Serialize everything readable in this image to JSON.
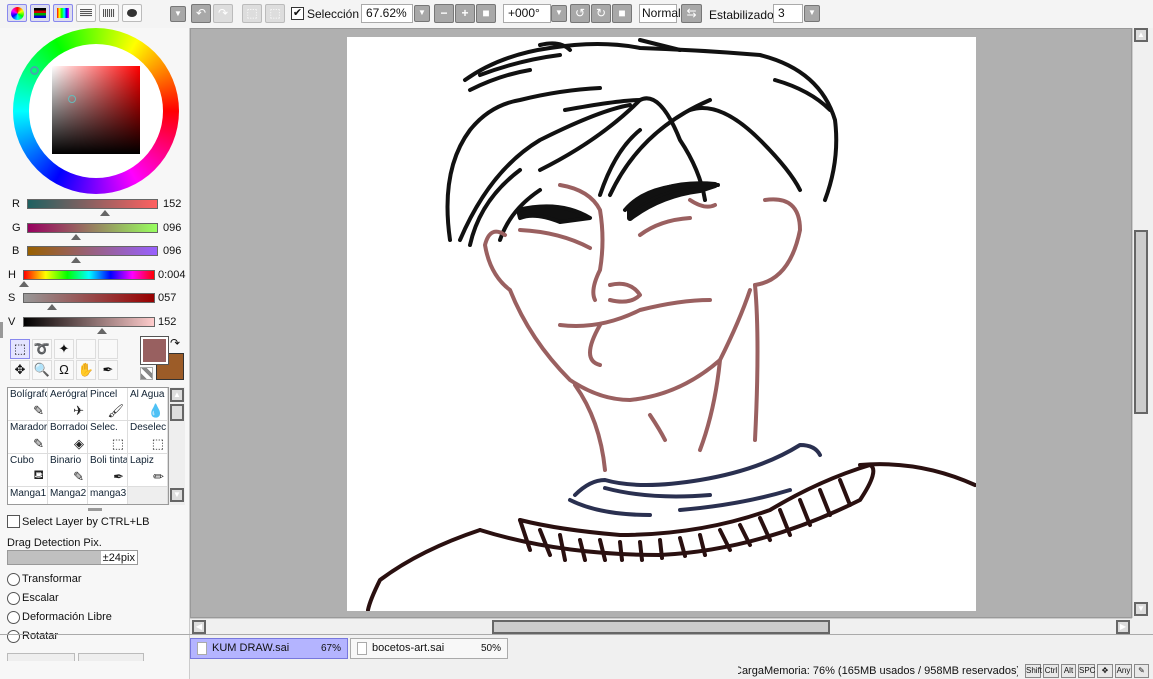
{
  "toolbar": {
    "selection_label": "Selección",
    "selection_checked": true,
    "zoom_value": "67.62%",
    "rotation_value": "+000°",
    "blend_mode": "Normal",
    "stabilizer_label": "Estabilizador",
    "stabilizer_value": "3"
  },
  "color": {
    "sliders": [
      {
        "label": "R",
        "value": "152",
        "fraction": 0.596
      },
      {
        "label": "G",
        "value": "096",
        "fraction": 0.376
      },
      {
        "label": "B",
        "value": "096",
        "fraction": 0.376
      },
      {
        "label": "H",
        "value": "0:004",
        "fraction": 0.01
      },
      {
        "label": "S",
        "value": "057",
        "fraction": 0.22
      },
      {
        "label": "V",
        "value": "152",
        "fraction": 0.596
      }
    ],
    "primary": "#986060",
    "secondary": "#9c5c28"
  },
  "brushes": [
    {
      "label": "Bolígrafo",
      "icon": "pen-icon",
      "glyph": "✎"
    },
    {
      "label": "Aerógrafo",
      "icon": "airbrush-icon",
      "glyph": "✈"
    },
    {
      "label": "Pincel",
      "icon": "brush-icon",
      "glyph": "🖌"
    },
    {
      "label": "Al Agua",
      "icon": "watercolor-icon",
      "glyph": "💧"
    },
    {
      "label": "Marador",
      "icon": "marker-icon",
      "glyph": "✎"
    },
    {
      "label": "Borrador",
      "icon": "eraser-icon",
      "glyph": "◈"
    },
    {
      "label": "Selec.",
      "icon": "select-pen-icon",
      "glyph": "⬚"
    },
    {
      "label": "Deselec.",
      "icon": "deselect-icon",
      "glyph": "⬚"
    },
    {
      "label": "Cubo",
      "icon": "bucket-icon",
      "glyph": "⛾"
    },
    {
      "label": "Binario",
      "icon": "binary-pen-icon",
      "glyph": "✎"
    },
    {
      "label": "Boli tinta",
      "icon": "ink-pen-icon",
      "glyph": "✒"
    },
    {
      "label": "Lapiz",
      "icon": "pencil-icon",
      "glyph": "✏"
    },
    {
      "label": "Manga1",
      "icon": "pen-icon",
      "glyph": "✒"
    },
    {
      "label": "Manga2",
      "icon": "pen-icon",
      "glyph": "✒"
    },
    {
      "label": "manga3",
      "icon": "pen-icon",
      "glyph": "✒"
    }
  ],
  "options": {
    "select_layer_label": "Select Layer by CTRL+LB",
    "drag_label": "Drag Detection Pix.",
    "drag_value": "±24pix",
    "drag_fraction": 0.72,
    "radios": [
      "Transformar",
      "Escalar",
      "Deformación Libre",
      "Rotatar"
    ]
  },
  "tabs": [
    {
      "name": "KUM DRAW.sai",
      "zoom": "67%",
      "active": true
    },
    {
      "name": "bocetos-art.sai",
      "zoom": "50%",
      "active": false
    }
  ],
  "status": {
    "memory": "CargaMemoria: 76% (165MB usados / 958MB reservados)",
    "keys": [
      "Shift",
      "Ctrl",
      "Alt",
      "SPC",
      "✥",
      "Any",
      "✎"
    ]
  }
}
